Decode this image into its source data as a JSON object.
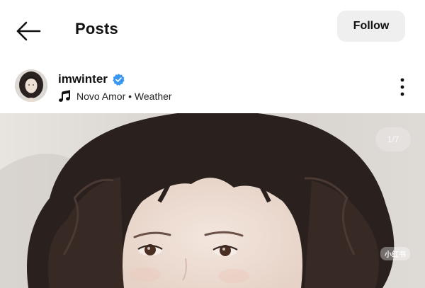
{
  "header": {
    "title": "Posts",
    "follow_label": "Follow"
  },
  "post": {
    "username": "imwinter",
    "verified": true,
    "music": "Novo Amor • Weather",
    "image_counter": "1/7",
    "watermark": "小红书"
  },
  "icons": {
    "back": "arrow-left",
    "verified": "verified-badge",
    "music": "music-note",
    "more": "vertical-ellipsis"
  },
  "colors": {
    "verified_blue": "#3897f0",
    "follow_button_bg": "#efefef",
    "text": "#111111"
  }
}
